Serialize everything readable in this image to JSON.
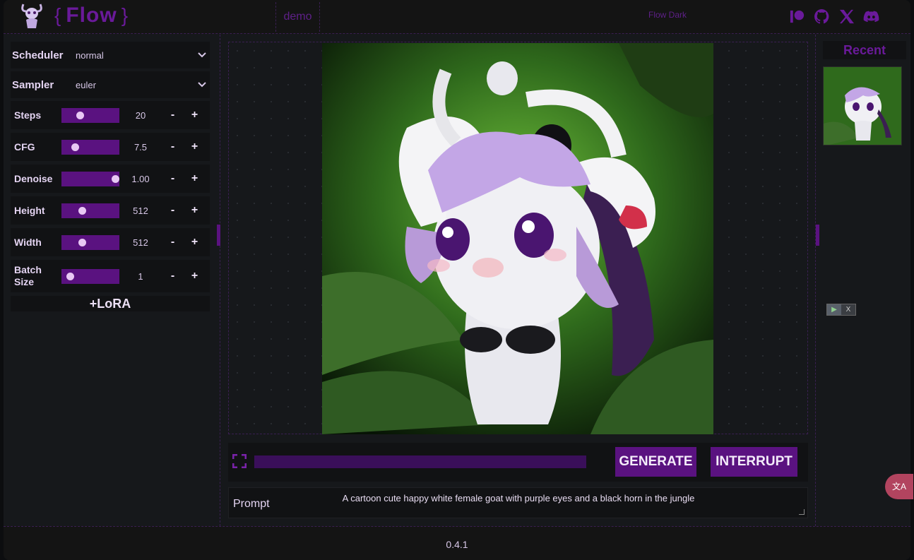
{
  "header": {
    "brand_open": "{",
    "brand_name": "Flow",
    "brand_close": "}",
    "nav_demo": "demo",
    "theme": "Flow Dark",
    "icons": [
      "patreon-icon",
      "github-icon",
      "x-icon",
      "discord-icon"
    ]
  },
  "sidebar": {
    "selects": [
      {
        "label": "Scheduler",
        "value": "normal"
      },
      {
        "label": "Sampler",
        "value": "euler"
      }
    ],
    "sliders": [
      {
        "label": "Steps",
        "value": "20",
        "level": 0.25
      },
      {
        "label": "CFG",
        "value": "7.5",
        "level": 0.15
      },
      {
        "label": "Denoise",
        "value": "1.00",
        "level": 1.0
      },
      {
        "label": "Height",
        "value": "512",
        "level": 0.3
      },
      {
        "label": "Width",
        "value": "512",
        "level": 0.3
      },
      {
        "label": "Batch Size",
        "value": "1",
        "level": 0.05
      }
    ],
    "minus": "-",
    "plus": "+",
    "lora_label": "+LoRA"
  },
  "main": {
    "generate_label": "GENERATE",
    "interrupt_label": "INTERRUPT",
    "progress": 0,
    "prompt_label": "Prompt",
    "prompt_text": "A cartoon cute happy white female goat with purple eyes and a black horn in the jungle"
  },
  "right": {
    "recent_title": "Recent",
    "mini_play": "▶",
    "mini_close": "X"
  },
  "footer": {
    "version": "0.4.1"
  },
  "colors": {
    "accent": "#5a1280",
    "brand": "#6a1a9a",
    "background": "#16181b"
  }
}
